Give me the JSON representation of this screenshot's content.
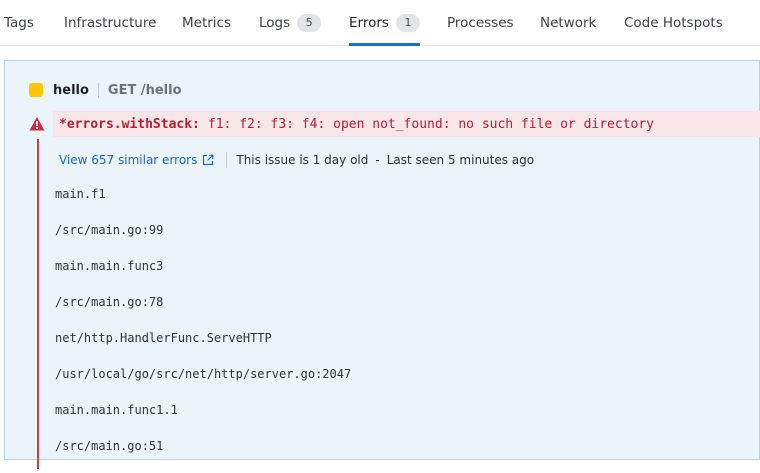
{
  "tabs": [
    {
      "label": "Tags",
      "badge": null,
      "active": false
    },
    {
      "label": "Infrastructure",
      "badge": null,
      "active": false
    },
    {
      "label": "Metrics",
      "badge": null,
      "active": false
    },
    {
      "label": "Logs",
      "badge": "5",
      "active": false
    },
    {
      "label": "Errors",
      "badge": "1",
      "active": true
    },
    {
      "label": "Processes",
      "badge": null,
      "active": false
    },
    {
      "label": "Network",
      "badge": null,
      "active": false
    },
    {
      "label": "Code Hotspots",
      "badge": null,
      "active": false
    }
  ],
  "span": {
    "service_name": "hello",
    "resource": "GET /hello",
    "service_color": "#ffc600"
  },
  "error": {
    "type": "*errors.withStack:",
    "message": "f1: f2: f3: f4: open not_found: no such file or directory",
    "similar_link": "View 657 similar errors",
    "age_text": "This issue is 1 day old",
    "separator": "-",
    "last_seen": "Last seen 5 minutes ago"
  },
  "stack_trace": [
    "main.f1",
    "/src/main.go:99",
    "main.main.func3",
    "/src/main.go:78",
    "net/http.HandlerFunc.ServeHTTP",
    "/usr/local/go/src/net/http/server.go:2047",
    "main.main.func1.1",
    "/src/main.go:51"
  ],
  "icons": {
    "warning": "warning-triangle-icon",
    "external_link": "external-link-icon"
  },
  "colors": {
    "accent": "#1f6fd0",
    "error_text": "#b32035",
    "error_bg": "#f9e6e8",
    "panel_bg": "#ebf4fb",
    "link": "#1d66c4"
  }
}
